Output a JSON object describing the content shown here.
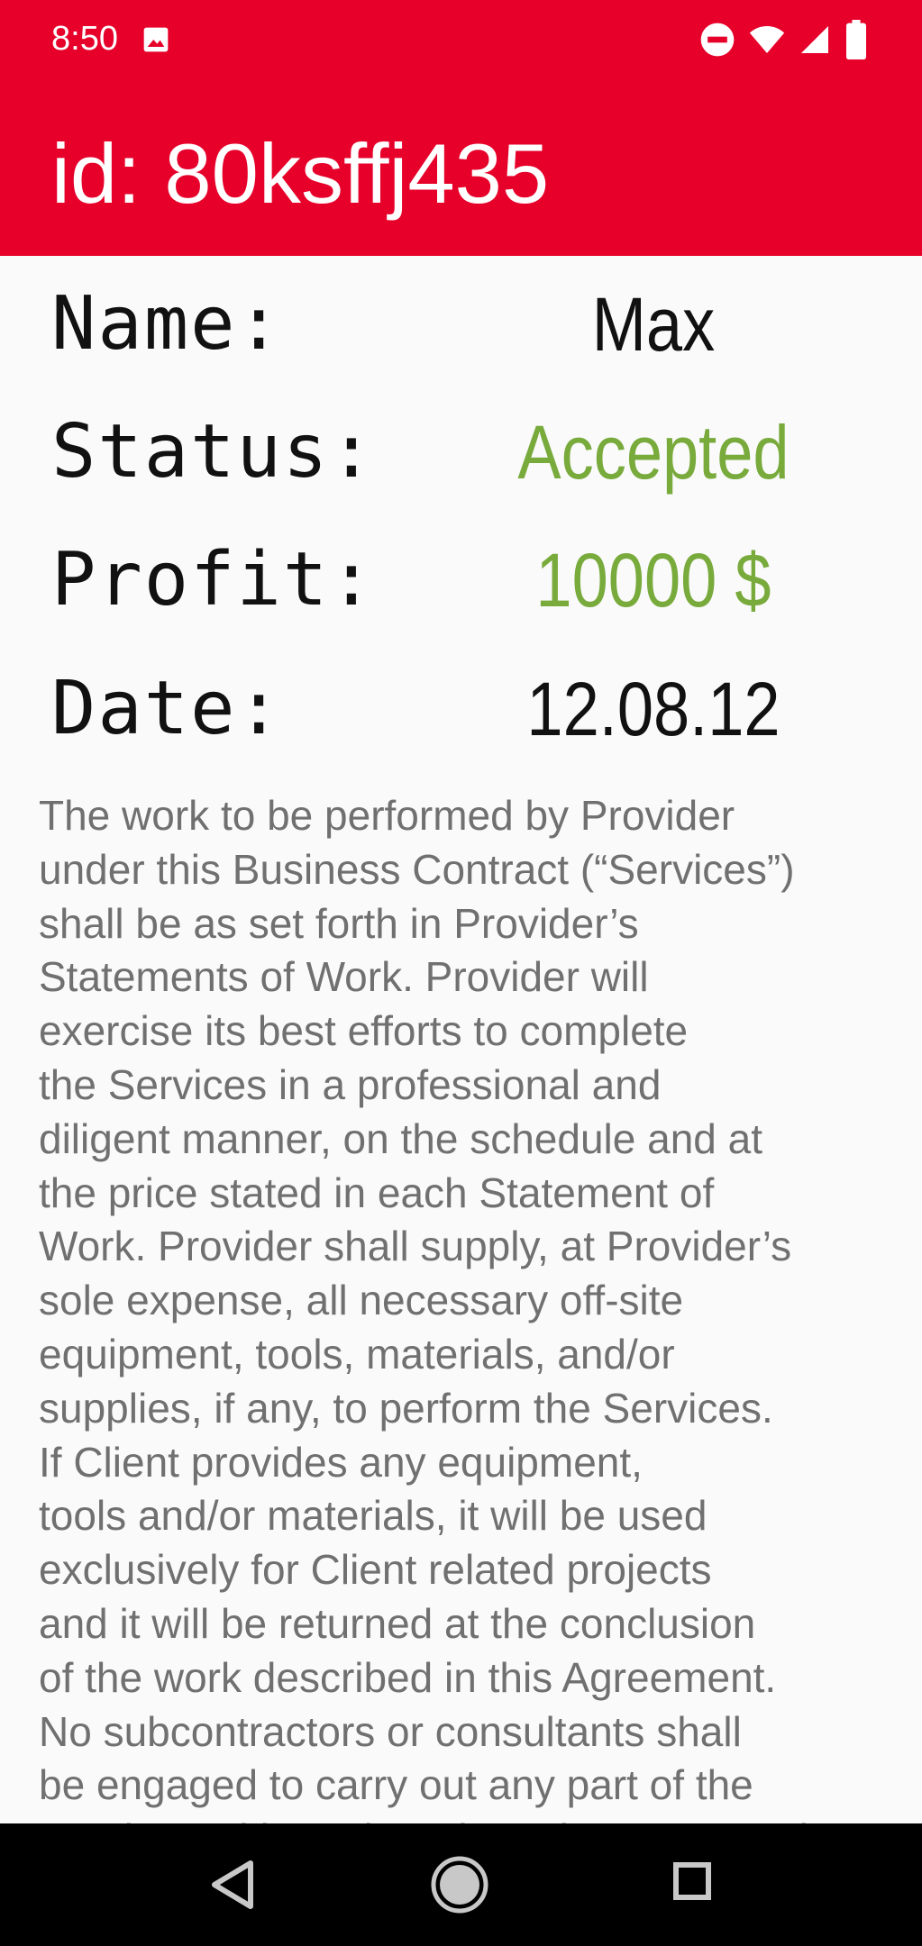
{
  "status_bar": {
    "time": "8:50",
    "icons": [
      "image-icon",
      "do-not-disturb-icon",
      "wifi-icon",
      "cell-signal-icon",
      "battery-icon"
    ]
  },
  "toolbar": {
    "title": "id: 80ksffj435",
    "background_color": "#e6002a"
  },
  "details": {
    "name": {
      "label": "Name:",
      "value": "Max"
    },
    "status": {
      "label": "Status:",
      "value": "Accepted",
      "value_color": "#78aa3c"
    },
    "profit": {
      "label": "Profit:",
      "value": "10000 $",
      "value_color": "#78aa3c"
    },
    "date": {
      "label": "Date:",
      "value": "12.08.12"
    }
  },
  "description": {
    "lines": [
      "The work to be performed by Provider",
      "under this Business Contract (“Services”)",
      "shall be as set forth in Provider’s",
      "Statements of Work. Provider will",
      "exercise its best efforts to complete",
      "the Services in a professional and",
      "diligent manner, on the schedule and at",
      "the price stated in each Statement of",
      "Work. Provider shall supply, at Provider’s",
      "sole expense, all necessary off-site",
      "equipment, tools, materials, and/or",
      "supplies, if any, to perform the Services.",
      "If Client provides any equipment,",
      "tools and/or materials, it will be used",
      "exclusively for Client related projects",
      "and it will be returned at the conclusion",
      "of the work described in this Agreement.",
      "No subcontractors or consultants shall",
      "be engaged to carry out any part of the",
      "Services without the prior written approval"
    ]
  },
  "nav_bar": {
    "buttons": [
      "back-icon",
      "home-icon",
      "recents-icon"
    ]
  }
}
